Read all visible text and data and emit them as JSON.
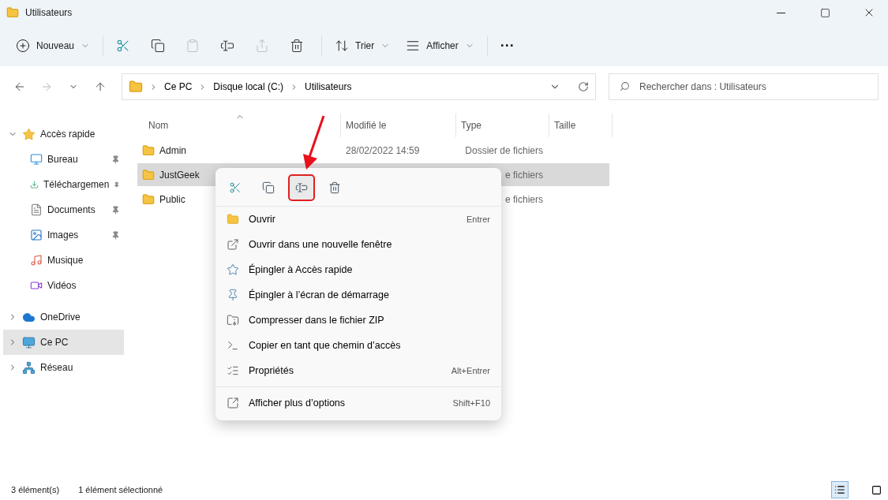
{
  "window": {
    "title": "Utilisateurs"
  },
  "toolbar": [
    {
      "kind": "menu",
      "label": "Nouveau",
      "disabled": false
    },
    {
      "kind": "icon",
      "disabled": false
    },
    {
      "kind": "icon",
      "disabled": false
    },
    {
      "kind": "icon",
      "disabled": true
    },
    {
      "kind": "icon",
      "disabled": false
    },
    {
      "kind": "icon",
      "disabled": true
    },
    {
      "kind": "icon",
      "disabled": false
    },
    {
      "kind": "menu",
      "label": "Trier",
      "disabled": false
    },
    {
      "kind": "menu",
      "label": "Afficher",
      "disabled": false
    },
    {
      "kind": "more",
      "label": "···",
      "disabled": false
    }
  ],
  "breadcrumb": [
    "Ce PC",
    "Disque local (C:)",
    "Utilisateurs"
  ],
  "search": {
    "placeholder": "Rechercher dans : Utilisateurs"
  },
  "sidebar": [
    {
      "label": "Accès rapide",
      "expanded": true,
      "selected": false,
      "children": [
        {
          "label": "Bureau",
          "pinned": true
        },
        {
          "label": "Téléchargemen",
          "pinned": true
        },
        {
          "label": "Documents",
          "pinned": true
        },
        {
          "label": "Images",
          "pinned": true
        },
        {
          "label": "Musique",
          "pinned": false
        },
        {
          "label": "Vidéos",
          "pinned": false
        }
      ]
    },
    {
      "label": "OneDrive",
      "expanded": false,
      "selected": false
    },
    {
      "label": "Ce PC",
      "expanded": false,
      "selected": true
    },
    {
      "label": "Réseau",
      "expanded": false,
      "selected": false
    }
  ],
  "table": {
    "columns": [
      "Nom",
      "Modifié le",
      "Type",
      "Taille"
    ],
    "rows": [
      {
        "name": "Admin",
        "modified": "28/02/2022 14:59",
        "type": "Dossier de fichiers",
        "selected": false
      },
      {
        "name": "JustGeek",
        "type": "e fichiers",
        "selected": true
      },
      {
        "name": "Public",
        "type": "e fichiers",
        "selected": false
      }
    ]
  },
  "context_menu": {
    "quick_actions": [
      {
        "selected": false
      },
      {
        "selected": false
      },
      {
        "selected": true
      },
      {
        "selected": false
      }
    ],
    "sections": [
      [
        {
          "label": "Ouvrir",
          "shortcut": "Entrer"
        },
        {
          "label": "Ouvrir dans une nouvelle fenêtre"
        },
        {
          "label": "Épingler à Accès rapide"
        },
        {
          "label": "Épingler à l’écran de démarrage"
        },
        {
          "label": "Compresser dans le fichier ZIP"
        },
        {
          "label": "Copier en tant que chemin d’accès"
        },
        {
          "label": "Propriétés",
          "shortcut": "Alt+Entrer"
        }
      ],
      [
        {
          "label": "Afficher plus d’options",
          "shortcut": "Shift+F10"
        }
      ]
    ]
  },
  "status_bar": {
    "count": "3 élément(s)",
    "selection": "1 élément sélectionné",
    "views": [
      {
        "selected": true
      },
      {
        "selected": false
      }
    ]
  }
}
